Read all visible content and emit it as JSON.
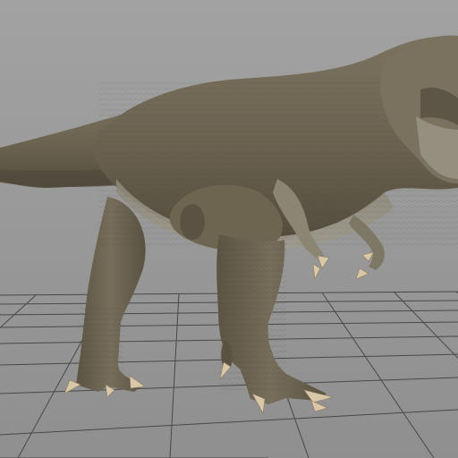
{
  "viewport": {
    "background_color": "#9b9b9b",
    "grid_color": "#3c3c3c",
    "grid_visible": true
  },
  "subject": {
    "kind": "tyrannosaurus-rex-3d-model",
    "skin_color": "#6f6652",
    "belly_color": "#8f8a7d",
    "claw_color": "#d9c8a8"
  }
}
